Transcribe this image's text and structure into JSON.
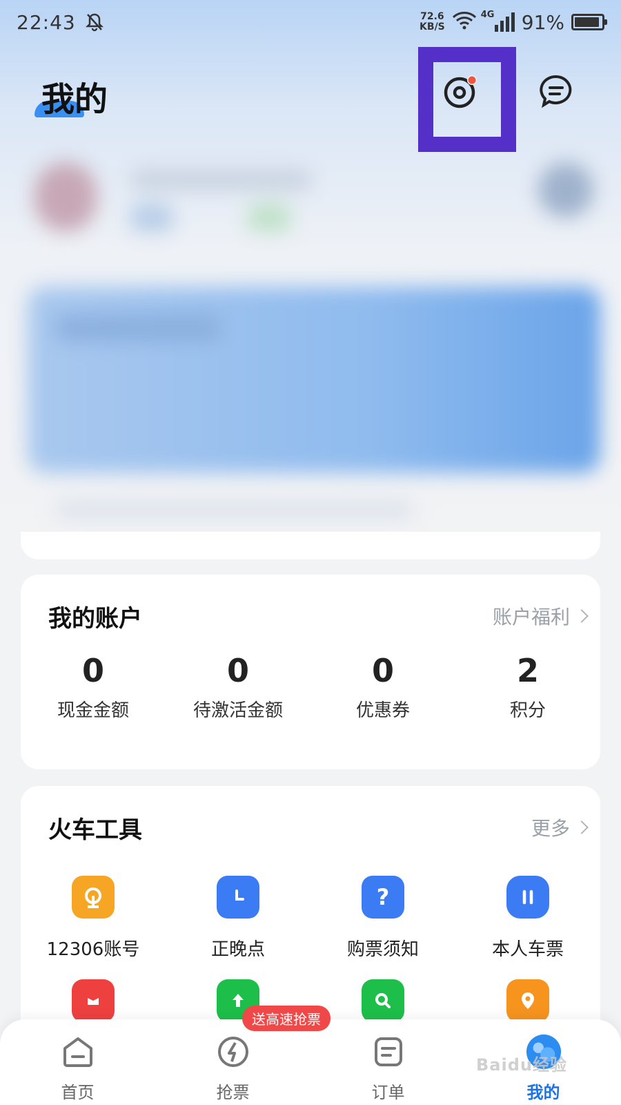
{
  "status_bar": {
    "time": "22:43",
    "net_speed_value": "72.6",
    "net_speed_unit": "KB/S",
    "network_type": "4G",
    "battery_percent": "91%",
    "battery_level": 0.91
  },
  "header": {
    "title": "我的",
    "settings_icon": "settings-icon",
    "settings_has_notification": true,
    "message_icon": "message-icon"
  },
  "highlight": {
    "color": "#5530c8"
  },
  "account": {
    "title": "我的账户",
    "link": "账户福利",
    "stats": [
      {
        "value": "0",
        "label": "现金金额"
      },
      {
        "value": "0",
        "label": "待激活金额"
      },
      {
        "value": "0",
        "label": "优惠券"
      },
      {
        "value": "2",
        "label": "积分"
      }
    ]
  },
  "tools": {
    "title": "火车工具",
    "link": "更多",
    "items": [
      {
        "label": "12306账号",
        "icon": "railway-logo-icon",
        "color": "#f6a524"
      },
      {
        "label": "正晚点",
        "icon": "clock-icon",
        "color": "#3b7cf5"
      },
      {
        "label": "购票须知",
        "icon": "question-icon",
        "color": "#3b7cf5"
      },
      {
        "label": "本人车票",
        "icon": "ticket-bag-icon",
        "color": "#3b7cf5"
      },
      {
        "label": "",
        "icon": "gift-ticket-icon",
        "color": "#ef4040"
      },
      {
        "label": "",
        "icon": "upload-ticket-icon",
        "color": "#1dbf4a"
      },
      {
        "label": "",
        "icon": "search-ticket-icon",
        "color": "#1dbf4a"
      },
      {
        "label": "",
        "icon": "location-icon",
        "color": "#f6941e"
      }
    ]
  },
  "bottom_nav": {
    "items": [
      {
        "label": "首页",
        "icon": "home-icon"
      },
      {
        "label": "抢票",
        "icon": "lightning-icon",
        "badge": "送高速抢票"
      },
      {
        "label": "订单",
        "icon": "order-icon"
      },
      {
        "label": "我的",
        "icon": "profile-icon",
        "active": true
      }
    ]
  },
  "watermark": "Baidu经验"
}
